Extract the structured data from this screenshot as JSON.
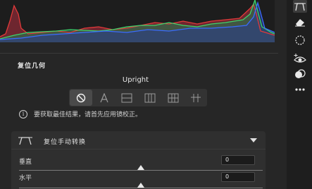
{
  "section": {
    "title": "复位几何"
  },
  "upright": {
    "label": "Upright",
    "modes": [
      {
        "icon": "no-entry-icon",
        "active": true
      },
      {
        "icon": "letter-a-auto-icon",
        "active": false
      },
      {
        "icon": "horizontal-guides-icon",
        "active": false
      },
      {
        "icon": "vertical-guides-icon",
        "active": false
      },
      {
        "icon": "full-grid-icon",
        "active": false
      },
      {
        "icon": "guided-crosshair-icon",
        "active": false
      }
    ]
  },
  "info": {
    "text": "要获取最佳结果，请首先应用镜校正。"
  },
  "manual_transform": {
    "title": "复位手动转换",
    "vertical": {
      "label": "垂直",
      "value": "0",
      "position": 0.5
    },
    "horizontal": {
      "label": "水平",
      "value": "0",
      "position": 0.5
    }
  },
  "toolstrip": {
    "tools": [
      "crop-transform-icon",
      "healing-eraser-icon",
      "mask-selection-icon",
      "red-eye-icon",
      "presets-toggle-icon",
      "more-options-icon"
    ]
  },
  "colors": {
    "panel_bg": "#262626",
    "histo_red": "#e03a3a",
    "histo_green": "#3cd46c",
    "histo_blue": "#3a6cff"
  }
}
